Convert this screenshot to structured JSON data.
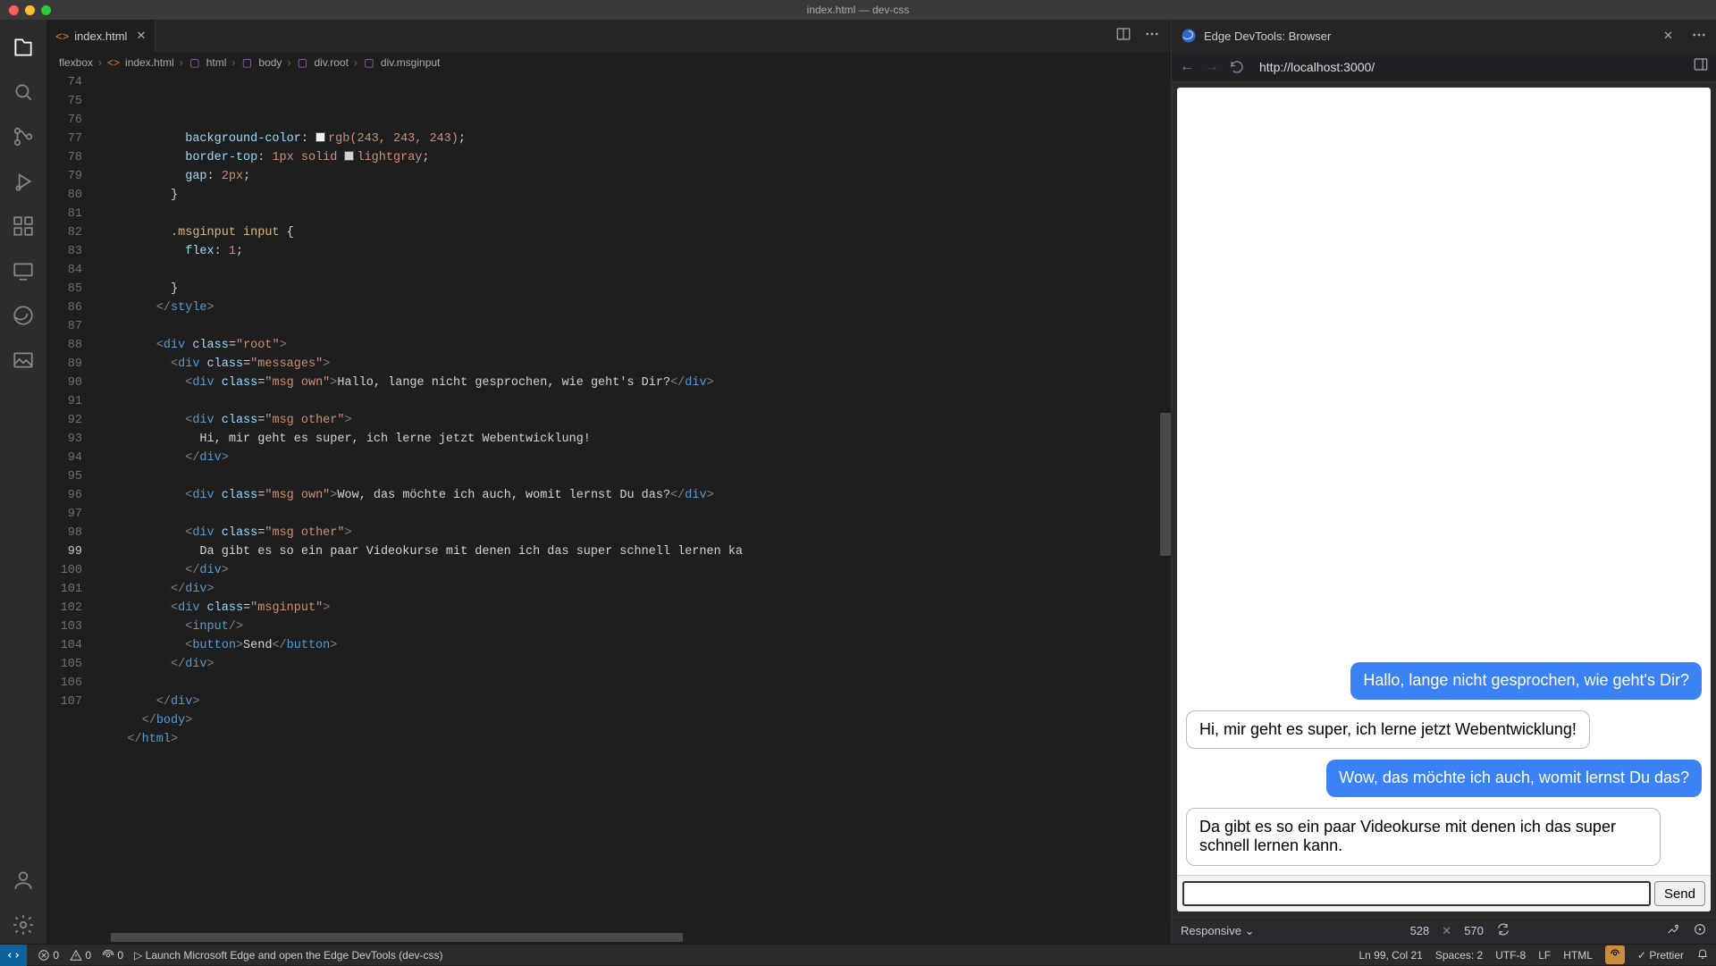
{
  "window": {
    "title": "index.html — dev-css"
  },
  "editor": {
    "tab": {
      "label": "index.html"
    },
    "breadcrumbs": [
      "flexbox",
      "index.html",
      "html",
      "body",
      "div.root",
      "div.msginput"
    ]
  },
  "codeLines": [
    {
      "n": 74,
      "kind": "css-prop",
      "indent": 12,
      "prop": "background-color",
      "chip": "#f3f3f3",
      "val": "rgb(243, 243, 243)",
      "term": ";"
    },
    {
      "n": 75,
      "kind": "css-prop",
      "indent": 12,
      "prop": "border-top",
      "val": "1px ",
      "kw": "solid",
      "chip2": "#d3d3d3",
      "val2": "lightgray",
      "term": ";"
    },
    {
      "n": 76,
      "kind": "css-prop",
      "indent": 12,
      "prop": "gap",
      "val": "2px",
      "term": ";"
    },
    {
      "n": 77,
      "kind": "plain",
      "indent": 10,
      "text": "}"
    },
    {
      "n": 78,
      "kind": "blank"
    },
    {
      "n": 79,
      "kind": "css-sel",
      "indent": 10,
      "text": ".msginput input {"
    },
    {
      "n": 80,
      "kind": "css-prop",
      "indent": 12,
      "prop": "flex",
      "val": "1",
      "term": ";"
    },
    {
      "n": 81,
      "kind": "blank"
    },
    {
      "n": 82,
      "kind": "plain",
      "indent": 10,
      "text": "}"
    },
    {
      "n": 83,
      "kind": "closetag",
      "indent": 8,
      "tag": "style"
    },
    {
      "n": 84,
      "kind": "blank"
    },
    {
      "n": 85,
      "kind": "opentag",
      "indent": 8,
      "tag": "div",
      "attrs": [
        [
          "class",
          "root"
        ]
      ]
    },
    {
      "n": 86,
      "kind": "opentag",
      "indent": 10,
      "tag": "div",
      "attrs": [
        [
          "class",
          "messages"
        ]
      ]
    },
    {
      "n": 87,
      "kind": "el-inline",
      "indent": 12,
      "tag": "div",
      "attrs": [
        [
          "class",
          "msg own"
        ]
      ],
      "inner": "Hallo, lange nicht gesprochen, wie geht's Dir?"
    },
    {
      "n": 88,
      "kind": "blank"
    },
    {
      "n": 89,
      "kind": "opentag",
      "indent": 12,
      "tag": "div",
      "attrs": [
        [
          "class",
          "msg other"
        ]
      ]
    },
    {
      "n": 90,
      "kind": "text",
      "indent": 14,
      "text": "Hi, mir geht es super, ich lerne jetzt Webentwicklung!"
    },
    {
      "n": 91,
      "kind": "closetag",
      "indent": 12,
      "tag": "div"
    },
    {
      "n": 92,
      "kind": "blank"
    },
    {
      "n": 93,
      "kind": "el-inline",
      "indent": 12,
      "tag": "div",
      "attrs": [
        [
          "class",
          "msg own"
        ]
      ],
      "inner": "Wow, das möchte ich auch, womit lernst Du das?"
    },
    {
      "n": 94,
      "kind": "blank"
    },
    {
      "n": 95,
      "kind": "opentag",
      "indent": 12,
      "tag": "div",
      "attrs": [
        [
          "class",
          "msg other"
        ]
      ]
    },
    {
      "n": 96,
      "kind": "text",
      "indent": 14,
      "text": "Da gibt es so ein paar Videokurse mit denen ich das super schnell lernen ka"
    },
    {
      "n": 97,
      "kind": "closetag",
      "indent": 12,
      "tag": "div"
    },
    {
      "n": 98,
      "kind": "closetag",
      "indent": 10,
      "tag": "div"
    },
    {
      "n": 99,
      "kind": "opentag",
      "indent": 10,
      "tag": "div",
      "attrs": [
        [
          "class",
          "msginput"
        ]
      ],
      "current": true
    },
    {
      "n": 100,
      "kind": "selfclose",
      "indent": 12,
      "tag": "input"
    },
    {
      "n": 101,
      "kind": "el-inline",
      "indent": 12,
      "tag": "button",
      "inner": "Send"
    },
    {
      "n": 102,
      "kind": "closetag",
      "indent": 10,
      "tag": "div"
    },
    {
      "n": 103,
      "kind": "blank"
    },
    {
      "n": 104,
      "kind": "closetag",
      "indent": 8,
      "tag": "div"
    },
    {
      "n": 105,
      "kind": "closetag",
      "indent": 6,
      "tag": "body"
    },
    {
      "n": 106,
      "kind": "closetag",
      "indent": 4,
      "tag": "html"
    },
    {
      "n": 107,
      "kind": "blank"
    }
  ],
  "devtools": {
    "title": "Edge DevTools: Browser",
    "url": "http://localhost:3000/",
    "page": {
      "messages": [
        {
          "type": "own",
          "text": "Hallo, lange nicht gesprochen, wie geht's Dir?"
        },
        {
          "type": "other",
          "text": "Hi, mir geht es super, ich lerne jetzt Webentwicklung!"
        },
        {
          "type": "own",
          "text": "Wow, das möchte ich auch, womit lernst Du das?"
        },
        {
          "type": "other",
          "text": "Da gibt es so ein paar Videokurse mit denen ich das super schnell lernen kann."
        }
      ],
      "sendLabel": "Send"
    },
    "viewport": {
      "mode": "Responsive",
      "width": "528",
      "height": "570"
    }
  },
  "status": {
    "errors": "0",
    "warnings": "0",
    "ports": "0",
    "launch": "Launch Microsoft Edge and open the Edge DevTools (dev-css)",
    "cursor": "Ln 99, Col 21",
    "spaces": "Spaces: 2",
    "encoding": "UTF-8",
    "eol": "LF",
    "lang": "HTML",
    "prettier": "Prettier"
  }
}
